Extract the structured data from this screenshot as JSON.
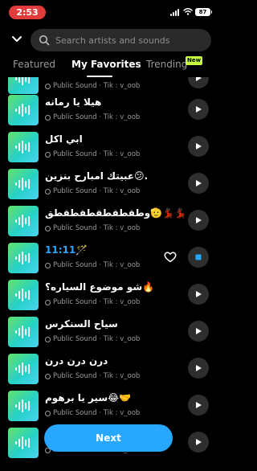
{
  "status_bar": {
    "time": "2:53",
    "battery": "87"
  },
  "search": {
    "placeholder": "Search artists and sounds"
  },
  "tabs": [
    {
      "label": "Featured"
    },
    {
      "label": "My Favorites"
    },
    {
      "label": "Trending"
    }
  ],
  "tab_badge": "New",
  "sounds": [
    {
      "title": "",
      "meta": "Public Sound · Tik : v_oob",
      "partial": true
    },
    {
      "title": "هيلا يا رمانه",
      "meta": "Public Sound · Tik : v_oob"
    },
    {
      "title": "ابي اكل",
      "meta": "Public Sound · Tik : v_oob"
    },
    {
      "title": "عبيتك امبارح بنزين😕.",
      "meta": "Public Sound · Tik : v_oob"
    },
    {
      "title": "وطقطقطقطقطقطق🫡💃🏿💃🏿",
      "meta": "Public Sound · Tik : v_oob"
    },
    {
      "title": "11:11🪄",
      "meta": "Public Sound · Tik : v_oob",
      "playing": true
    },
    {
      "title": "شو موضوع السياره؟🔥",
      "meta": "Public Sound · Tik : v_oob"
    },
    {
      "title": "سياح السنكرس",
      "meta": "Public Sound · Tik : v_oob"
    },
    {
      "title": "درن درن درن",
      "meta": "Public Sound · Tik : v_oob"
    },
    {
      "title": "سير يا برهوم😂🤝",
      "meta": "Public Sound · Tik : v_oob"
    },
    {
      "title": "",
      "meta": "Public Sound · Tik : v_oob"
    }
  ],
  "next_button": "Next",
  "colors": {
    "accent": "#27a7ff",
    "badge": "#c6ff3e",
    "status_pill": "#e23b3b"
  }
}
